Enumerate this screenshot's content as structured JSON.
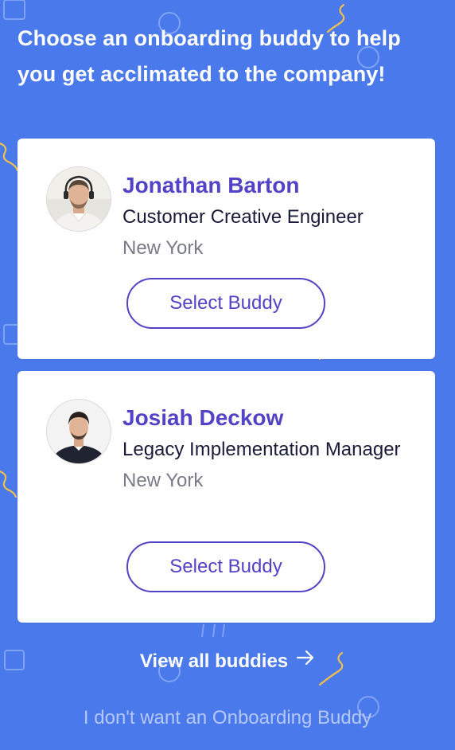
{
  "header": {
    "title": "Choose an onboarding buddy to help you get acclimated to the company!"
  },
  "buddies": [
    {
      "name": "Jonathan Barton",
      "role": "Customer Creative Engineer",
      "location": "New York",
      "button_label": "Select Buddy",
      "avatar": "person-photo"
    },
    {
      "name": "Josiah Deckow",
      "role": "Legacy Implementation Manager",
      "location": "New York",
      "button_label": "Select Buddy",
      "avatar": "person-photo"
    }
  ],
  "footer": {
    "view_all_label": "View all buddies",
    "view_all_icon": "arrow-right-icon",
    "decline_label": "I don't want an Onboarding Buddy"
  },
  "colors": {
    "background": "#4a79eb",
    "accent": "#5242c7",
    "decoration": "#f0c04a"
  }
}
